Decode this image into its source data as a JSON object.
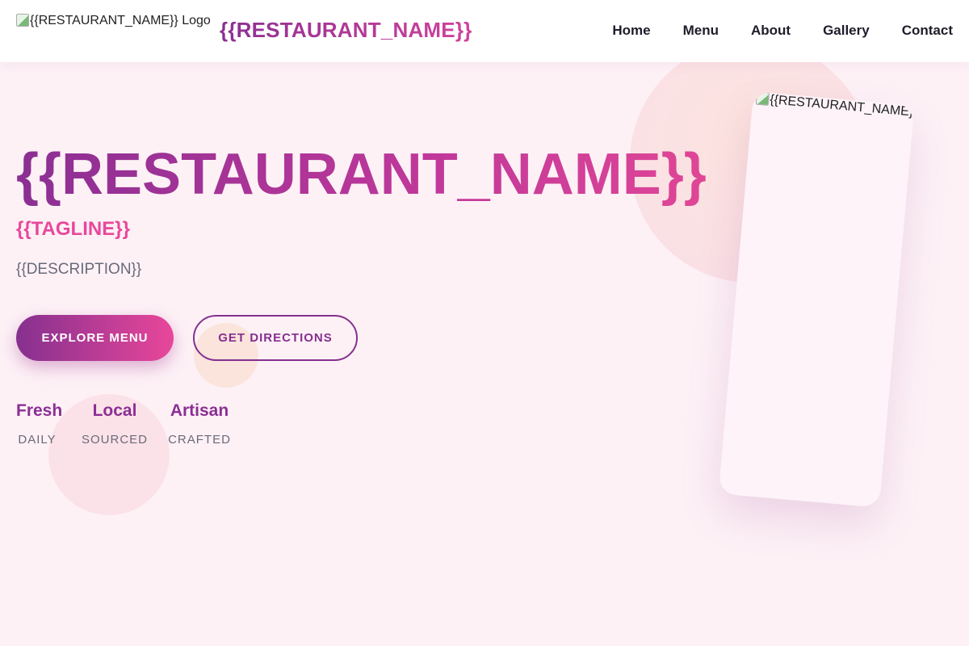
{
  "header": {
    "logo_alt": "{{RESTAURANT_NAME}} Logo",
    "brand_name": "{{RESTAURANT_NAME}}",
    "nav": [
      {
        "label": "Home"
      },
      {
        "label": "Menu"
      },
      {
        "label": "About"
      },
      {
        "label": "Gallery"
      },
      {
        "label": "Contact"
      }
    ]
  },
  "hero": {
    "title": "{{RESTAURANT_NAME}}",
    "tagline": "{{TAGLINE}}",
    "description": "{{DESCRIPTION}}",
    "primary_button": "EXPLORE MENU",
    "secondary_button": "GET DIRECTIONS",
    "stats": [
      {
        "value": "Fresh",
        "label": "DAILY"
      },
      {
        "value": "Local",
        "label": "SOURCED"
      },
      {
        "value": "Artisan",
        "label": "CRAFTED"
      }
    ],
    "image_alt": "{{RESTAURANT_NAME}}"
  },
  "colors": {
    "brand_purple": "#8b2f93",
    "brand_pink": "#e8479a",
    "background": "#fdf1f6",
    "text_dark": "#1d1d2b",
    "text_muted": "#6a6a7a"
  }
}
